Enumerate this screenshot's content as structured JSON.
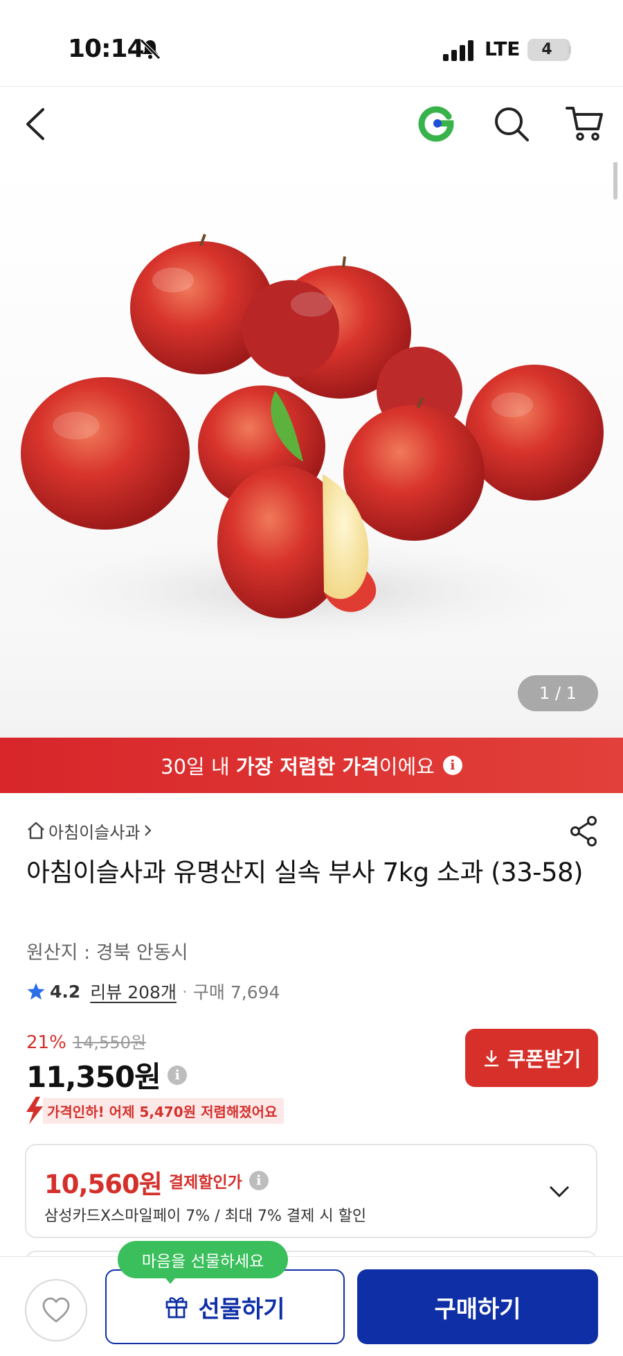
{
  "status_bar": {
    "time": "10:14",
    "network": "LTE",
    "battery": "4"
  },
  "header": {
    "back_icon": "back-arrow-icon",
    "logo_icon": "gmarket-g-logo",
    "search_icon": "search-icon",
    "cart_icon": "cart-icon"
  },
  "gallery": {
    "counter": "1 / 1"
  },
  "promo": {
    "prefix": "30일 내 ",
    "highlight": "가장 저렴한 가격",
    "suffix": "이에요"
  },
  "product": {
    "store_name": "아침이슬사과",
    "title": "아침이슬사과 유명산지 실속 부사 7kg 소과 (33-58)",
    "origin": "원산지 : 경북 안동시",
    "rating": "4.2",
    "review_label": "리뷰 208개",
    "purchase_count": "구매 7,694"
  },
  "price": {
    "discount_rate": "21%",
    "original": "14,550원",
    "sale": "11,350원",
    "coupon_label": "쿠폰받기",
    "price_drop_note": "가격인하! 어제 5,470원 저렴해졌어요"
  },
  "card_discount": {
    "price": "10,560원",
    "label": "결제할인가",
    "description": "삼성카드X스마일페이 7% / 최대 7% 결제 시 할인"
  },
  "bottom_bar": {
    "gift_bubble": "마음을 선물하세요",
    "gift_label": "선물하기",
    "buy_label": "구매하기"
  },
  "colors": {
    "accent_red": "#d7302a",
    "primary_blue": "#0f2fa6",
    "bubble_green": "#3bbf5c"
  }
}
